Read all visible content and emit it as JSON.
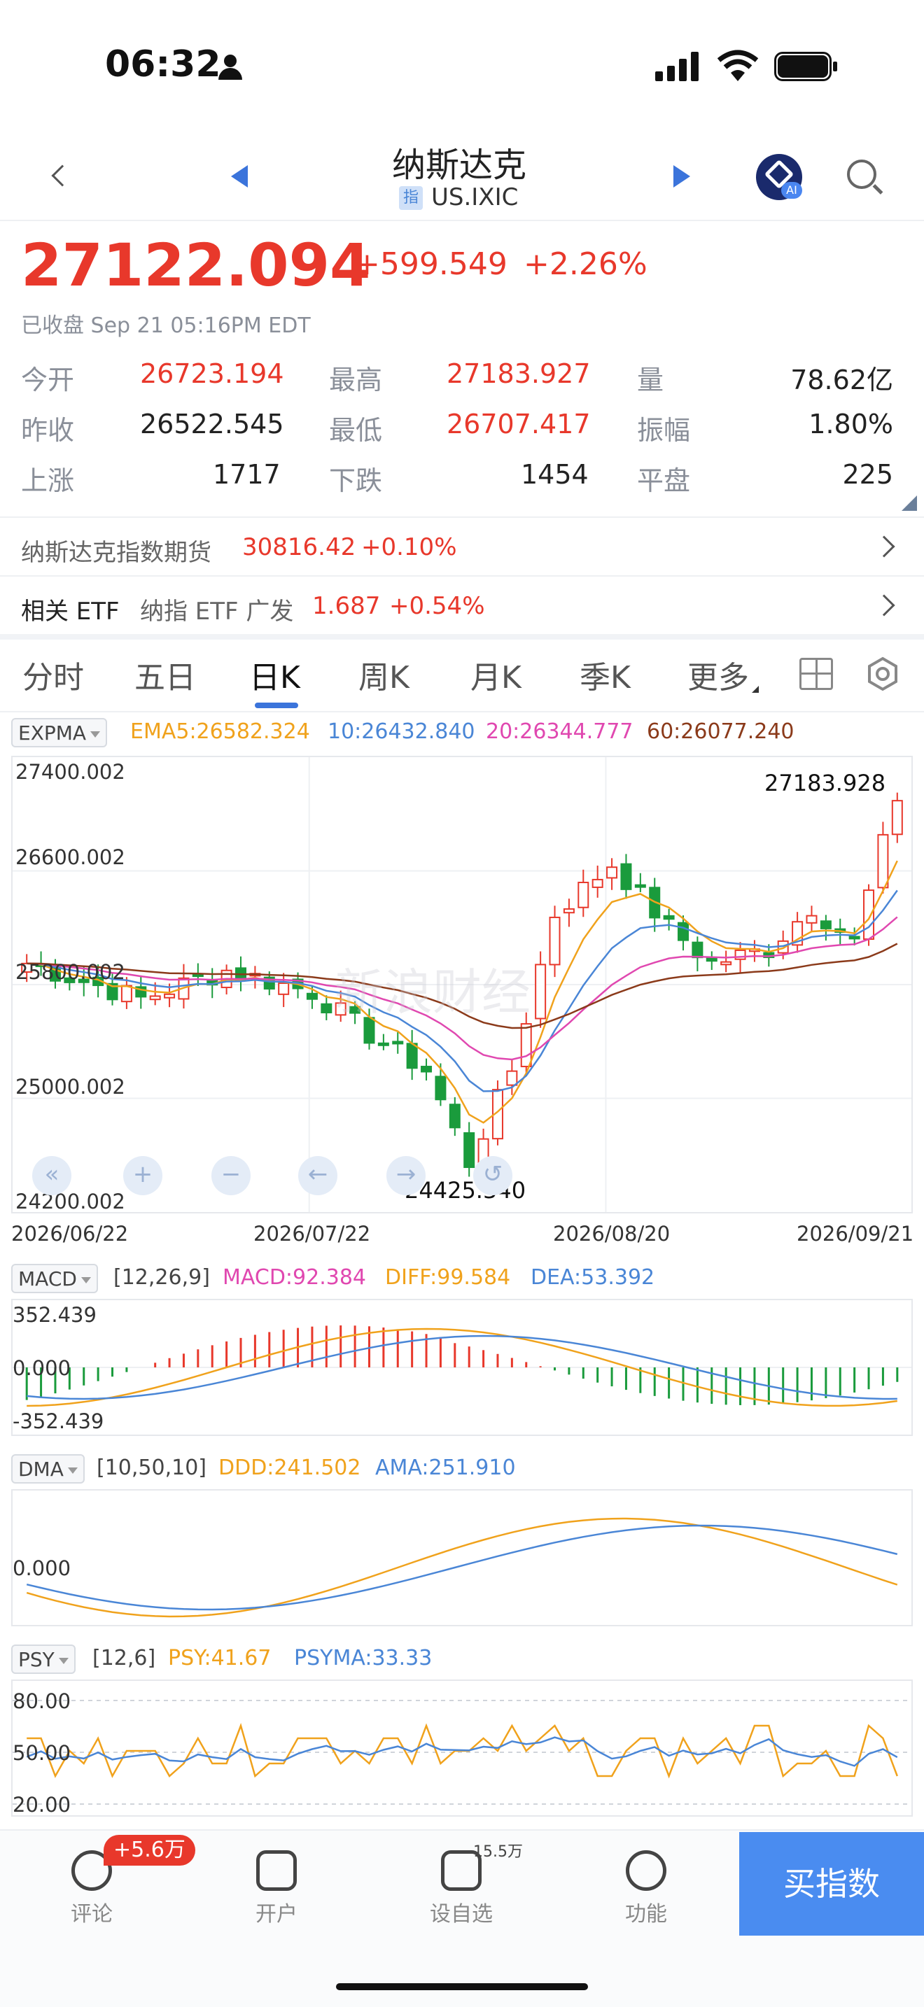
{
  "status_bar": {
    "time": "06:32"
  },
  "header": {
    "title": "纳斯达克",
    "symbol_badge": "指",
    "symbol": "US.IXIC",
    "ai_badge": "AI"
  },
  "quote": {
    "price": "27122.094",
    "change": "+599.549",
    "change_pct": "+2.26%",
    "status": "已收盘 Sep 21 05:16PM EDT"
  },
  "stats": {
    "open_label": "今开",
    "open": "26723.194",
    "high_label": "最高",
    "high": "27183.927",
    "volume_label": "量",
    "volume": "78.62亿",
    "prev_close_label": "昨收",
    "prev_close": "26522.545",
    "low_label": "最低",
    "low": "26707.417",
    "amplitude_label": "振幅",
    "amplitude": "1.80%",
    "up_label": "上涨",
    "up": "1717",
    "down_label": "下跌",
    "down": "1454",
    "flat_label": "平盘",
    "flat": "225"
  },
  "futures": {
    "label": "纳斯达克指数期货",
    "value": "30816.42",
    "change": "+0.10%"
  },
  "etf": {
    "label": "相关 ETF",
    "name": "纳指 ETF 广发",
    "value": "1.687",
    "change": "+0.54%"
  },
  "tabs": [
    "分时",
    "五日",
    "日K",
    "周K",
    "月K",
    "季K",
    "更多"
  ],
  "active_tab": "日K",
  "main_chart": {
    "indicator": "EXPMA",
    "ema5": "EMA5:26582.324",
    "ema10": "10:26432.840",
    "ema20": "20:26344.777",
    "ema60": "60:26077.240",
    "y_ticks": [
      "27400.002",
      "26600.002",
      "25800.002",
      "25000.002",
      "24200.002"
    ],
    "high_marker": "27183.928",
    "low_marker": "24425.340",
    "x_ticks": [
      "2026/06/22",
      "2026/07/22",
      "2026/08/20",
      "2026/09/21"
    ],
    "watermark": "新浪财经"
  },
  "macd": {
    "indicator": "MACD",
    "params": "[12,26,9]",
    "macd": "MACD:92.384",
    "diff": "DIFF:99.584",
    "dea": "DEA:53.392",
    "y_ticks": [
      "352.439",
      "0.000",
      "-352.439"
    ]
  },
  "dma": {
    "indicator": "DMA",
    "params": "[10,50,10]",
    "ddd": "DDD:241.502",
    "ama": "AMA:251.910",
    "y_ticks": [
      "0.000"
    ]
  },
  "psy": {
    "indicator": "PSY",
    "params": "[12,6]",
    "psy": "PSY:41.67",
    "psyma": "PSYMA:33.33",
    "y_ticks": [
      "80.00",
      "50.00",
      "20.00"
    ]
  },
  "bottom_bar": {
    "comment_label": "评论",
    "comment_badge": "+5.6万",
    "account_label": "开户",
    "watch_label": "设自选",
    "watch_count": "15.5万",
    "func_label": "功能",
    "buy_label": "买指数"
  },
  "colors": {
    "up": "#e8382b",
    "down": "#1a9b3c",
    "ema5": "#f0a21c",
    "ema10": "#4a86d6",
    "ema20": "#e048b0",
    "ema60": "#8b3a1a",
    "buy_button": "#4a8cf0"
  },
  "chart_data": {
    "type": "candlestick",
    "x_range": [
      "2026/06/22",
      "2026/09/21"
    ],
    "y_range": [
      24200.002,
      27400.002
    ],
    "high": 27183.928,
    "low": 24425.34,
    "last_close": 27122.094
  }
}
